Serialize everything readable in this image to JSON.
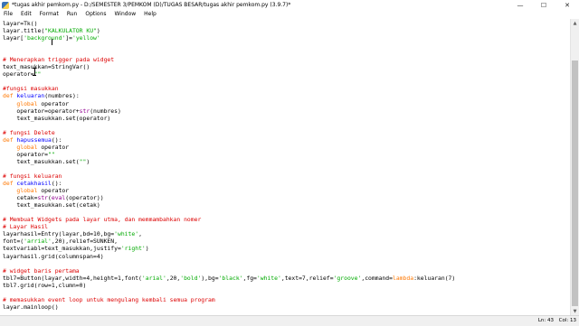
{
  "window": {
    "title": "*tugas akhir pemkom.py - D:/SEMESTER 3/PEMKOM (D)/TUGAS BESAR/tugas akhir pemkom.py (3.9.7)*",
    "minimize_glyph": "—",
    "maximize_glyph": "☐",
    "close_glyph": "✕"
  },
  "menu": {
    "items": [
      {
        "label": "File"
      },
      {
        "label": "Edit"
      },
      {
        "label": "Format"
      },
      {
        "label": "Run"
      },
      {
        "label": "Options"
      },
      {
        "label": "Window"
      },
      {
        "label": "Help"
      }
    ]
  },
  "code_lines": [
    [
      {
        "t": "layar=Tk()"
      }
    ],
    [
      {
        "t": "layar.title("
      },
      {
        "t": "\"KALKULATOR KU\"",
        "c": "str"
      },
      {
        "t": ")"
      }
    ],
    [
      {
        "t": "layar["
      },
      {
        "t": "'background'",
        "c": "str"
      },
      {
        "t": "]="
      },
      {
        "t": "'yellow'",
        "c": "str"
      }
    ],
    [],
    [],
    [
      {
        "t": "# Menerapkan trigger pada widget",
        "c": "cmt"
      }
    ],
    [
      {
        "t": "text_masukkan=StringVar()"
      }
    ],
    [
      {
        "t": "operator="
      },
      {
        "t": "\"\"",
        "c": "str"
      }
    ],
    [],
    [
      {
        "t": "#fungsi masukkan",
        "c": "cmt"
      }
    ],
    [
      {
        "t": "def",
        "c": "kw"
      },
      {
        "t": " "
      },
      {
        "t": "keluaran",
        "c": "fn"
      },
      {
        "t": "(numbres):"
      }
    ],
    [
      {
        "t": "    "
      },
      {
        "t": "global",
        "c": "kw"
      },
      {
        "t": " operator"
      }
    ],
    [
      {
        "t": "    operator=operator+"
      },
      {
        "t": "str",
        "c": "bi"
      },
      {
        "t": "(numbres)"
      }
    ],
    [
      {
        "t": "    text_masukkan.set(operator)"
      }
    ],
    [],
    [
      {
        "t": "# fungsi Delete",
        "c": "cmt"
      }
    ],
    [
      {
        "t": "def",
        "c": "kw"
      },
      {
        "t": " "
      },
      {
        "t": "hapussemua",
        "c": "fn"
      },
      {
        "t": "():"
      }
    ],
    [
      {
        "t": "    "
      },
      {
        "t": "global",
        "c": "kw"
      },
      {
        "t": " operator"
      }
    ],
    [
      {
        "t": "    operator="
      },
      {
        "t": "\"\"",
        "c": "str"
      }
    ],
    [
      {
        "t": "    text_masukkan.set("
      },
      {
        "t": "\"\"",
        "c": "str"
      },
      {
        "t": ")"
      }
    ],
    [],
    [
      {
        "t": "# fungsi keluaran",
        "c": "cmt"
      }
    ],
    [
      {
        "t": "def",
        "c": "kw"
      },
      {
        "t": " "
      },
      {
        "t": "cetakhasil",
        "c": "fn"
      },
      {
        "t": "():"
      }
    ],
    [
      {
        "t": "    "
      },
      {
        "t": "global",
        "c": "kw"
      },
      {
        "t": " operator"
      }
    ],
    [
      {
        "t": "    cetak="
      },
      {
        "t": "str",
        "c": "bi"
      },
      {
        "t": "("
      },
      {
        "t": "eval",
        "c": "bi"
      },
      {
        "t": "(operator))"
      }
    ],
    [
      {
        "t": "    text_masukkan.set(cetak)"
      }
    ],
    [],
    [
      {
        "t": "# Membuat Widgets pada layar utma, dan memmambahkan nomer",
        "c": "cmt"
      }
    ],
    [
      {
        "t": "# Layar Hasil",
        "c": "cmt"
      }
    ],
    [
      {
        "t": "layarhasil=Entry(layar,bd=10,bg="
      },
      {
        "t": "'white'",
        "c": "str"
      },
      {
        "t": ","
      }
    ],
    [
      {
        "t": "font=("
      },
      {
        "t": "'arrial'",
        "c": "str"
      },
      {
        "t": ",20),relief=SUNKEN,"
      }
    ],
    [
      {
        "t": "textvariabl=text_masukkan,justify="
      },
      {
        "t": "'right'",
        "c": "str"
      },
      {
        "t": ")"
      }
    ],
    [
      {
        "t": "layarhasil.grid(columnspan=4)"
      }
    ],
    [],
    [
      {
        "t": "# widget baris pertama",
        "c": "cmt"
      }
    ],
    [
      {
        "t": "tbl7=Button(layar,width=4,height=1,font("
      },
      {
        "t": "'arial'",
        "c": "str"
      },
      {
        "t": ",20,"
      },
      {
        "t": "'bold'",
        "c": "str"
      },
      {
        "t": "),bg="
      },
      {
        "t": "'black'",
        "c": "str"
      },
      {
        "t": ",fg="
      },
      {
        "t": "'white'",
        "c": "str"
      },
      {
        "t": ",text=7,relief="
      },
      {
        "t": "'groove'",
        "c": "str"
      },
      {
        "t": ",command="
      },
      {
        "t": "lambda",
        "c": "kw"
      },
      {
        "t": ":keluaran(7)"
      }
    ],
    [
      {
        "t": "tbl7.grid(row=1,clumn=0)"
      }
    ],
    [],
    [
      {
        "t": "# memasukkan event loop untuk mengulang kembali semua program",
        "c": "cmt"
      }
    ],
    [
      {
        "t": "layar.mainloop()"
      }
    ]
  ],
  "scrollbar": {
    "up_glyph": "▲",
    "down_glyph": "▼"
  },
  "status": {
    "line": "Ln: 43",
    "col": "Col: 13"
  }
}
